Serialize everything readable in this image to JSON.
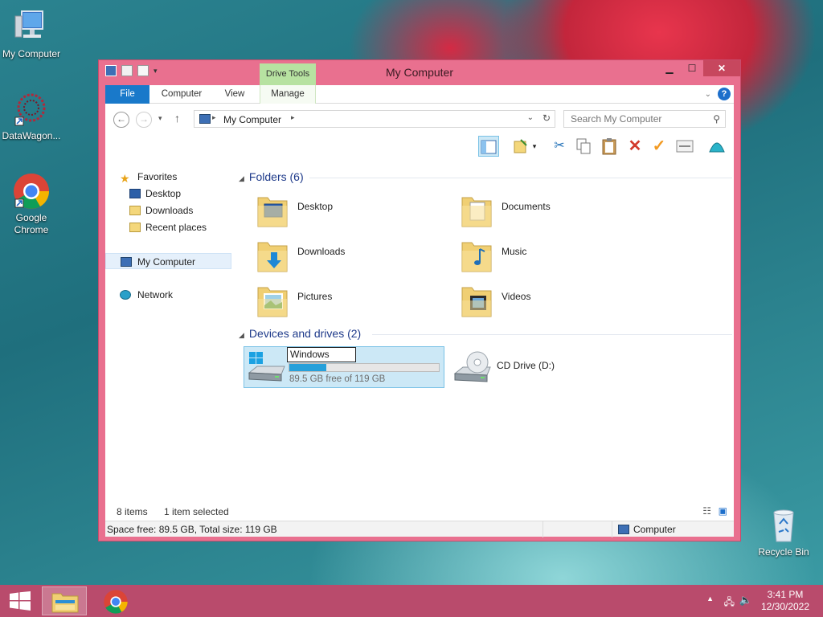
{
  "desktop": {
    "icons": [
      {
        "label": "My Computer"
      },
      {
        "label": "DataWagon..."
      },
      {
        "label": "Google Chrome"
      },
      {
        "label": "Recycle Bin"
      }
    ]
  },
  "window": {
    "title": "My Computer",
    "contextual_tab": "Drive Tools",
    "tabs": [
      {
        "label": "File"
      },
      {
        "label": "Computer"
      },
      {
        "label": "View"
      },
      {
        "label": "Manage"
      }
    ],
    "help_glyph": "?",
    "close_glyph": "✕"
  },
  "address": {
    "path": "My Computer",
    "search_placeholder": "Search My Computer"
  },
  "navigation": {
    "favorites": "Favorites",
    "desktop": "Desktop",
    "downloads": "Downloads",
    "recent": "Recent places",
    "computer": "My Computer",
    "network": "Network"
  },
  "content": {
    "folders_header": "Folders (6)",
    "folders": [
      {
        "name": "Desktop",
        "icon": "desktop-folder-icon"
      },
      {
        "name": "Documents",
        "icon": "documents-folder-icon"
      },
      {
        "name": "Downloads",
        "icon": "downloads-folder-icon"
      },
      {
        "name": "Music",
        "icon": "music-folder-icon"
      },
      {
        "name": "Pictures",
        "icon": "pictures-folder-icon"
      },
      {
        "name": "Videos",
        "icon": "videos-folder-icon"
      }
    ],
    "devices_header": "Devices and drives (2)",
    "drive": {
      "rename_value": "Windows",
      "free_text": "89.5 GB free of 119 GB",
      "used_fraction": 0.248
    },
    "cd_drive": "CD Drive (D:)"
  },
  "status": {
    "items": "8 items",
    "selected": "1 item selected",
    "space": "Space free: 89.5 GB, Total size: 119 GB",
    "location": "Computer"
  },
  "taskbar": {
    "time": "3:41 PM",
    "date": "12/30/2022"
  },
  "colors": {
    "accent": "#1979ca",
    "window_frame": "#e9708f",
    "taskbar": "#b94b6c",
    "drive_tools": "#b7e2a1",
    "selection": "#cce8f6"
  }
}
